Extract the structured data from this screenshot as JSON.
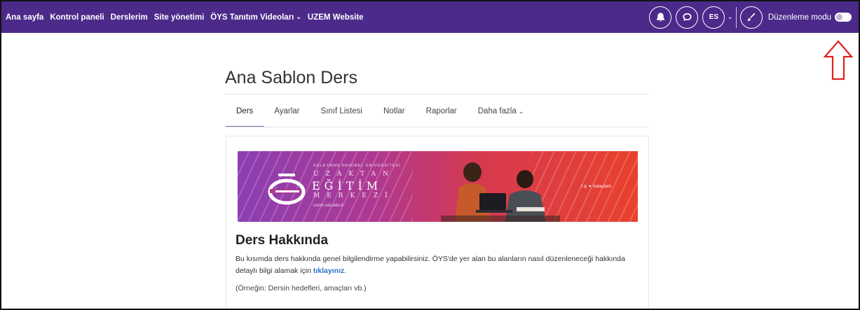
{
  "nav": {
    "links": [
      {
        "label": "Ana sayfa"
      },
      {
        "label": "Kontrol paneli"
      },
      {
        "label": "Derslerim"
      },
      {
        "label": "Site yönetimi"
      },
      {
        "label": "ÖYS Tanıtım Videoları",
        "caret": "⌄"
      },
      {
        "label": "UZEM Website"
      }
    ],
    "lang": "ES",
    "edit_mode_label": "Düzenleme modu",
    "accent": "#4b2a8a"
  },
  "page": {
    "title": "Ana Sablon Ders"
  },
  "tabs": [
    {
      "label": "Ders",
      "active": true
    },
    {
      "label": "Ayarlar"
    },
    {
      "label": "Sınıf Listesi"
    },
    {
      "label": "Notlar"
    },
    {
      "label": "Raporlar"
    },
    {
      "label": "Daha fazla",
      "caret": "⌄"
    }
  ],
  "banner": {
    "university": "SÜLEYMAN DEMİREL ÜNİVERSİTESİ",
    "word1": "UZAKTAN",
    "word2": "EĞİTİM",
    "word3": "MERKEZİ",
    "url": "uzem.sdu.edu.tr",
    "social": "f  ◎  ✦  /sduuzem"
  },
  "content": {
    "section_title": "Ders Hakkında",
    "desc_before": "Bu kısımda ders hakkında genel bilgilendirme yapabilirsiniz. ÖYS'de yer alan bu alanların nasıl düzenleneceği hakkında detaylı bilgi alamak için ",
    "desc_link": "tıklayınız",
    "desc_after": ".",
    "example": "(Örneğin: Dersin hedefleri, amaçları vb.)"
  }
}
